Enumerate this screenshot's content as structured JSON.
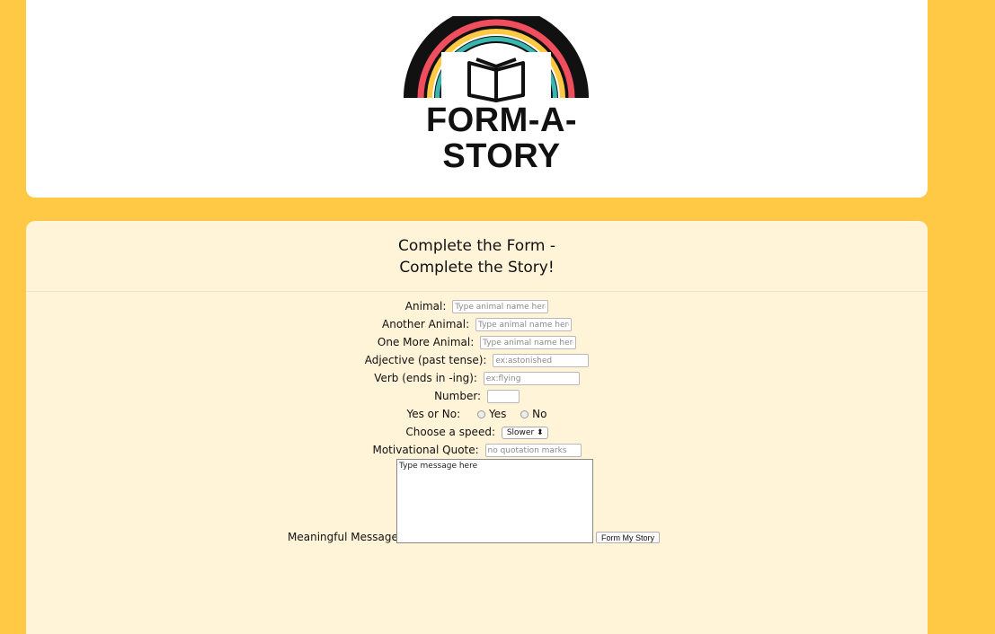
{
  "brand": {
    "logo_text": "FORM-A-STORY",
    "colors": {
      "red": "#f04e5e",
      "yellow": "#ffc845",
      "teal": "#38b6b0",
      "ink": "#111111",
      "page_bg": "#ffc845",
      "form_bg": "#fff3d8"
    }
  },
  "form": {
    "title_line1": "Complete the Form -",
    "title_line2": "Complete the Story!",
    "fields": {
      "animal": {
        "label": "Animal:",
        "placeholder": "Type animal name here"
      },
      "another_animal": {
        "label": "Another Animal:",
        "placeholder": "Type animal name here"
      },
      "one_more_animal": {
        "label": "One More Animal:",
        "placeholder": "Type animal name here"
      },
      "adjective": {
        "label": "Adjective (past tense):",
        "placeholder": "ex:astonished"
      },
      "verb": {
        "label": "Verb (ends in -ing):",
        "placeholder": "ex:flying"
      },
      "number": {
        "label": "Number:",
        "placeholder": ""
      },
      "yes_no": {
        "label": "Yes or No:",
        "options": [
          "Yes",
          "No"
        ]
      },
      "speed": {
        "label": "Choose a speed:",
        "selected": "Slower",
        "arrow": "⬍"
      },
      "quote": {
        "label": "Motivational Quote:",
        "placeholder": "no quotation marks"
      },
      "message": {
        "label": "Meaningful Message:",
        "value": "Type message here"
      }
    },
    "submit_label": "Form My Story"
  }
}
